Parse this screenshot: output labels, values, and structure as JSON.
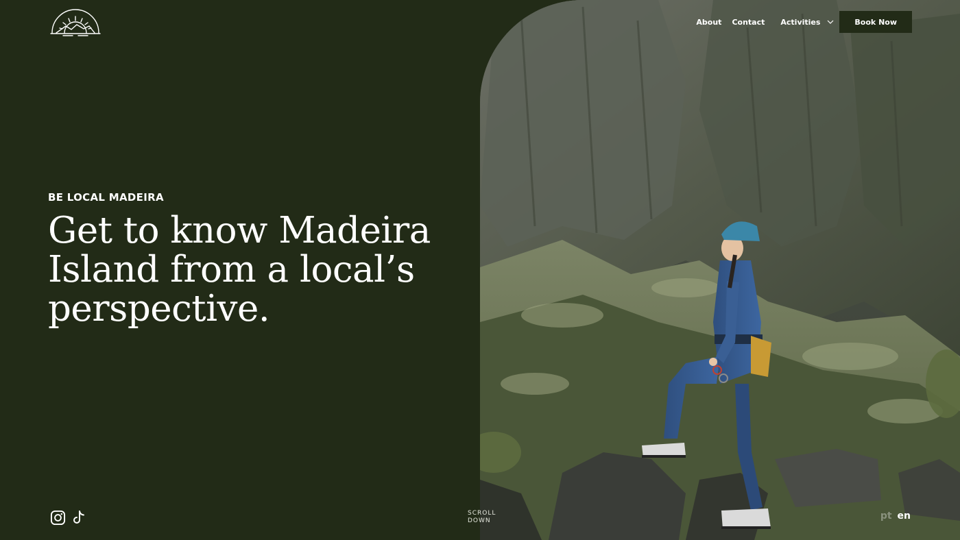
{
  "brand": {
    "logo_icon": "sunrise-mountain-logo-icon"
  },
  "nav": {
    "about": "About",
    "contact": "Contact",
    "activities": "Activities",
    "book_now": "Book Now"
  },
  "hero": {
    "eyebrow": "BE LOCAL MADEIRA",
    "line1": "Get to know Madeira",
    "line2": "Island from a local’s",
    "line3": "perspective.",
    "scroll_line1": "SCROLL",
    "scroll_line2": "DOWN",
    "image_icon": "canyoning-woman-mountain-photo"
  },
  "social": {
    "instagram_icon": "instagram-icon",
    "tiktok_icon": "tiktok-icon"
  },
  "language": {
    "pt": "pt",
    "en": "en",
    "selected": "en"
  },
  "colors": {
    "background": "#222b17",
    "text": "#ffffff"
  }
}
